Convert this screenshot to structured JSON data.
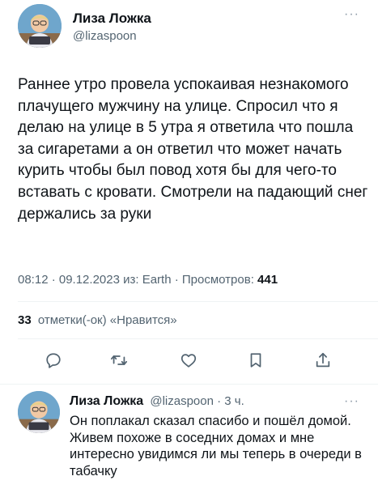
{
  "tweet": {
    "author_name": "Лиза Ложка",
    "author_handle": "@lizaspoon",
    "text": "Раннее утро провела успокаивая незнакомого плачущего мужчину на улице. Спросил что я делаю на улице в 5 утра я ответила что пошла за сигаретами а он ответил что может начать курить чтобы был повод хотя бы для чего-то вставать с кровати. Смотрели на падающий снег держались за руки",
    "meta_prefix": "08:12 · 09.12.2023 из: Earth · Просмотров:",
    "views": "441",
    "likes_count": "33",
    "likes_label": "отметки(-ок) «Нравится»",
    "more_label": "···"
  },
  "actions": {
    "reply_icon": "reply-icon",
    "retweet_icon": "retweet-icon",
    "like_icon": "heart-icon",
    "bookmark_icon": "bookmark-icon",
    "share_icon": "share-icon"
  },
  "reply": {
    "author_name": "Лиза Ложка",
    "meta": "@lizaspoon · 3 ч.",
    "text": "Он поплакал сказал спасибо и пошёл домой. Живем похоже в соседних домах и мне интересно увидимся ли мы теперь в очереди в табачку",
    "more_label": "···"
  },
  "colors": {
    "text_primary": "#0f1419",
    "text_secondary": "#536471",
    "divider": "#eff3f4",
    "avatar_bg": "#6fa6cc"
  }
}
